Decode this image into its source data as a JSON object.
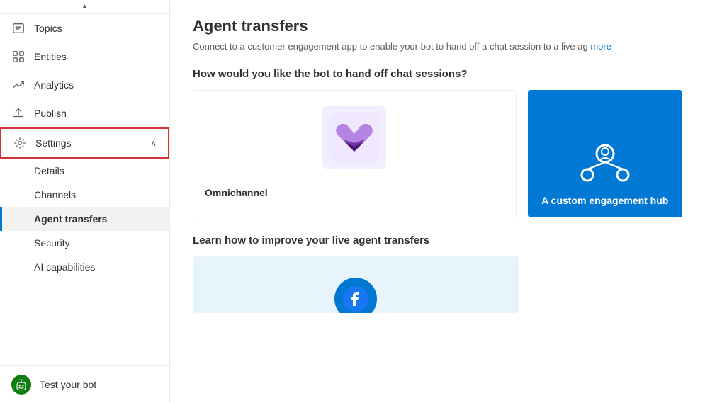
{
  "sidebar": {
    "top_arrow": "▲",
    "nav_items": [
      {
        "id": "topics",
        "label": "Topics",
        "icon": "chat"
      },
      {
        "id": "entities",
        "label": "Entities",
        "icon": "grid"
      },
      {
        "id": "analytics",
        "label": "Analytics",
        "icon": "trending-up"
      },
      {
        "id": "publish",
        "label": "Publish",
        "icon": "upload"
      },
      {
        "id": "settings",
        "label": "Settings",
        "icon": "gear",
        "has_chevron": true,
        "expanded": true,
        "active": true
      }
    ],
    "sub_items": [
      {
        "id": "details",
        "label": "Details"
      },
      {
        "id": "channels",
        "label": "Channels"
      },
      {
        "id": "agent-transfers",
        "label": "Agent transfers",
        "active": true
      },
      {
        "id": "security",
        "label": "Security"
      },
      {
        "id": "ai-capabilities",
        "label": "AI capabilities"
      }
    ],
    "bottom": {
      "label": "Test your bot",
      "icon": "bot"
    }
  },
  "main": {
    "title": "Agent transfers",
    "subtitle": "Connect to a customer engagement app to enable your bot to hand off a chat session to a live ag",
    "subtitle_link": "more",
    "hand_off_title": "How would you like the bot to hand off chat sessions?",
    "cards": [
      {
        "id": "omnichannel",
        "label": "Omnichannel",
        "type": "omnichannel"
      },
      {
        "id": "custom-hub",
        "label": "A custom engagement hub",
        "type": "custom"
      }
    ],
    "learn_title": "Learn how to improve your live agent transfers",
    "learn_cards": [
      {
        "id": "learn-1",
        "type": "facebook"
      }
    ]
  }
}
